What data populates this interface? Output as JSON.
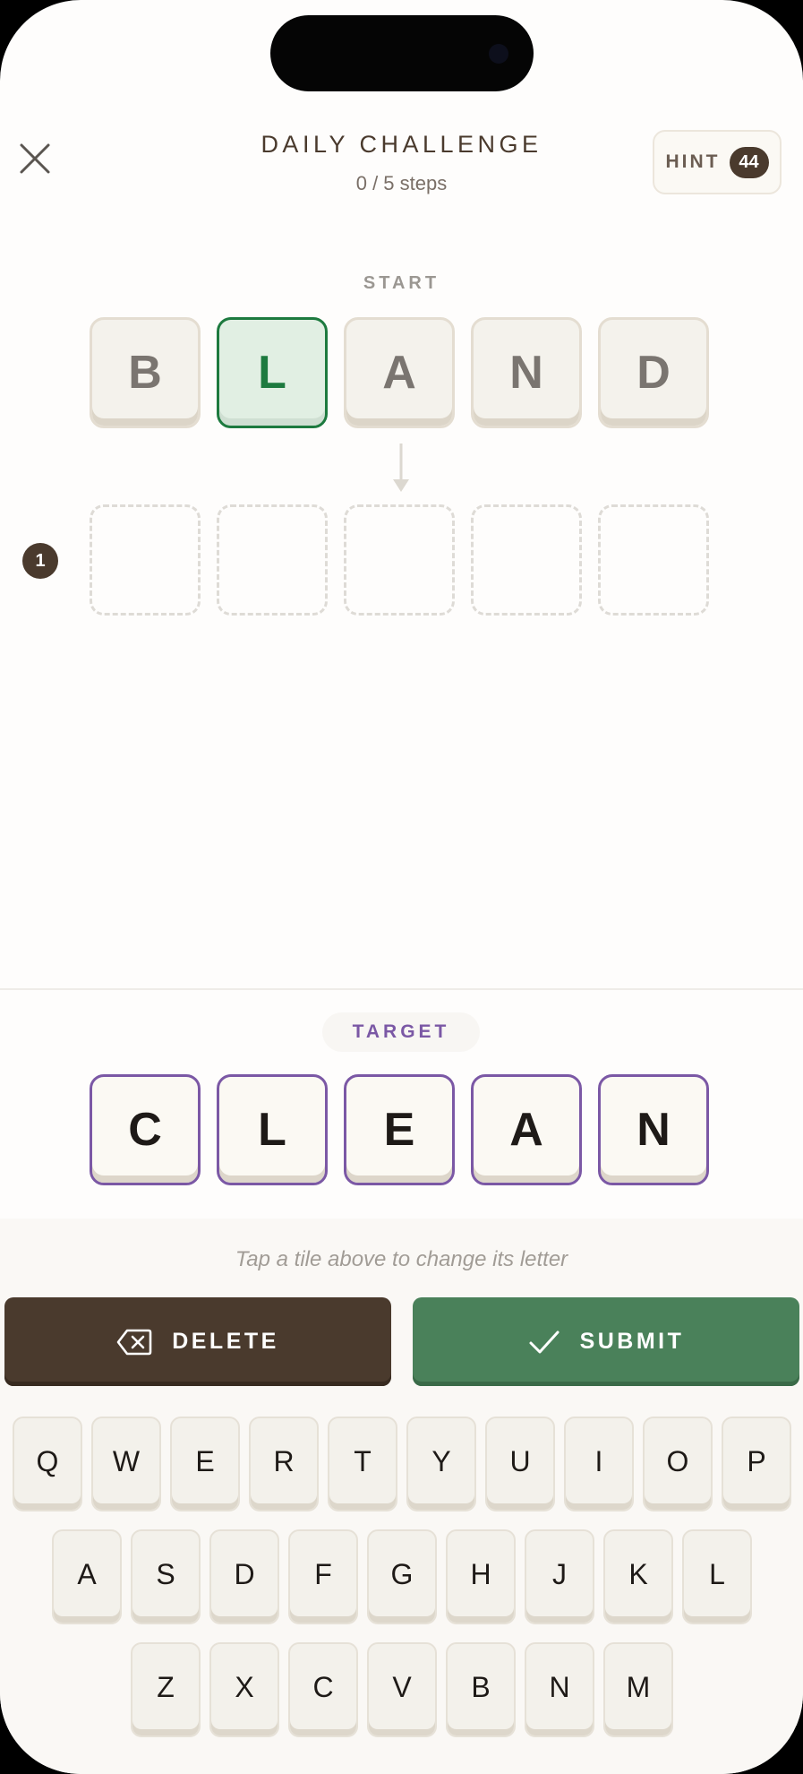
{
  "header": {
    "title": "DAILY CHALLENGE",
    "steps": "0 / 5 steps",
    "hint_label": "HINT",
    "hint_count": "44"
  },
  "start": {
    "label": "START",
    "letters": [
      "B",
      "L",
      "A",
      "N",
      "D"
    ],
    "selected_index": 1
  },
  "steps_list": [
    {
      "number": "1",
      "letters": [
        "",
        "",
        "",
        "",
        ""
      ]
    }
  ],
  "target": {
    "label": "TARGET",
    "letters": [
      "C",
      "L",
      "E",
      "A",
      "N"
    ]
  },
  "instruction": "Tap a tile above to change its letter",
  "actions": {
    "delete_label": "DELETE",
    "submit_label": "SUBMIT"
  },
  "keyboard": {
    "rows": [
      [
        "Q",
        "W",
        "E",
        "R",
        "T",
        "Y",
        "U",
        "I",
        "O",
        "P"
      ],
      [
        "A",
        "S",
        "D",
        "F",
        "G",
        "H",
        "J",
        "K",
        "L"
      ],
      [
        "Z",
        "X",
        "C",
        "V",
        "B",
        "N",
        "M"
      ]
    ]
  },
  "colors": {
    "brown": "#4a3a2d",
    "green": "#4a815a",
    "selected_green": "#1d7a3f",
    "target_purple": "#7b58a5"
  }
}
